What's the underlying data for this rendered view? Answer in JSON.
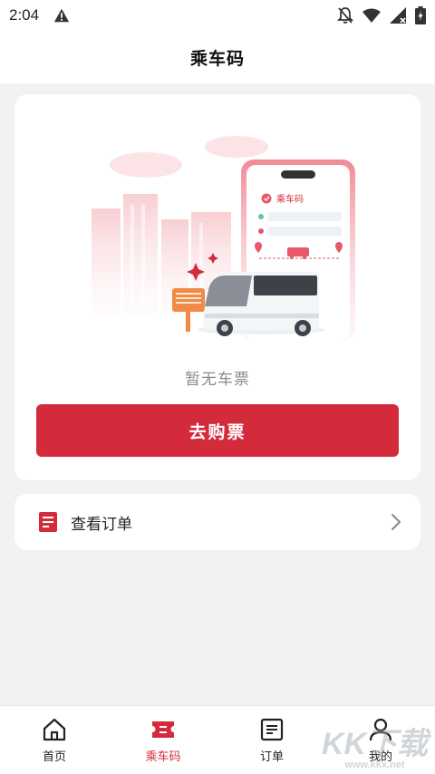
{
  "status_bar": {
    "time": "2:04",
    "battery_level_percent": 100
  },
  "header": {
    "title": "乘车码"
  },
  "ticket_card": {
    "illustration": {
      "phone_title": "乘车码"
    },
    "empty_text": "暂无车票",
    "buy_button_label": "去购票"
  },
  "orders": {
    "label": "查看订单"
  },
  "tabbar": {
    "tabs": [
      {
        "label": "首页",
        "icon": "home-icon",
        "active": false
      },
      {
        "label": "乘车码",
        "icon": "ticket-icon",
        "active": true
      },
      {
        "label": "订单",
        "icon": "order-list-icon",
        "active": false
      },
      {
        "label": "我的",
        "icon": "person-icon",
        "active": false
      }
    ]
  },
  "watermark": {
    "main": "KK下载",
    "sub": "www.kkx.net"
  },
  "colors": {
    "accent": "#d42b3c",
    "background": "#f2f2f2",
    "card": "#ffffff"
  }
}
